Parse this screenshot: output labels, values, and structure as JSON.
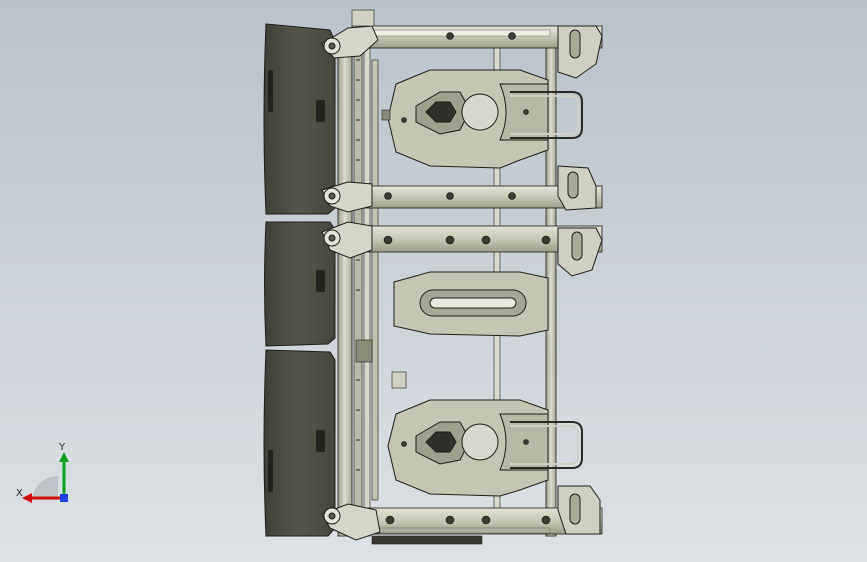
{
  "viewport": {
    "background_top": "#b9c3cc",
    "background_bottom": "#dde2e6"
  },
  "model": {
    "description_icon": "cad-assembly-icon",
    "colors": {
      "cushion": "#4f5043",
      "frame": "#c7c8b6",
      "frame_dark": "#8f907e",
      "edge": "#1e1e1a",
      "highlight": "#e6e7da"
    }
  },
  "triad": {
    "x_label": "X",
    "y_label": "Y",
    "x_color": "#d01010",
    "y_color": "#10a020",
    "z_color": "#2040e0"
  }
}
